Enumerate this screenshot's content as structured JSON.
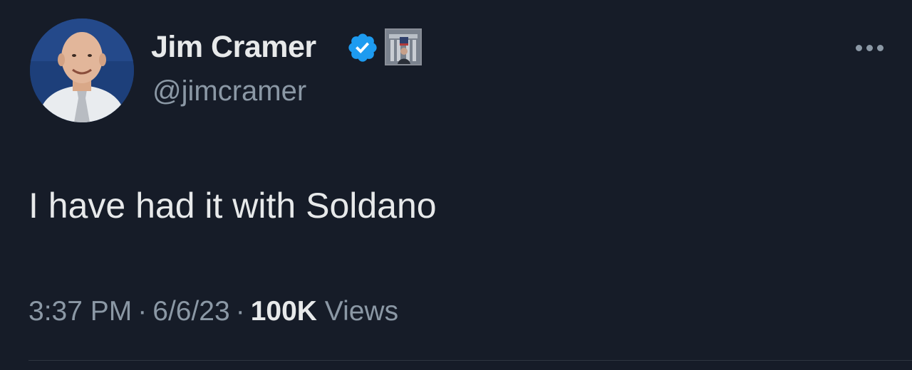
{
  "user": {
    "display_name": "Jim Cramer",
    "handle": "@jimcramer",
    "verified_icon": "verified-badge-icon",
    "verified_color": "#1d9bf0"
  },
  "tweet": {
    "text": "I have had it with Soldano",
    "time": "3:37 PM",
    "separator": "·",
    "date": "6/6/23",
    "views_count": "100K",
    "views_label": "Views"
  },
  "colors": {
    "background": "#161c28",
    "primary_text": "#e7e9ea",
    "secondary_text": "#8b98a5"
  }
}
